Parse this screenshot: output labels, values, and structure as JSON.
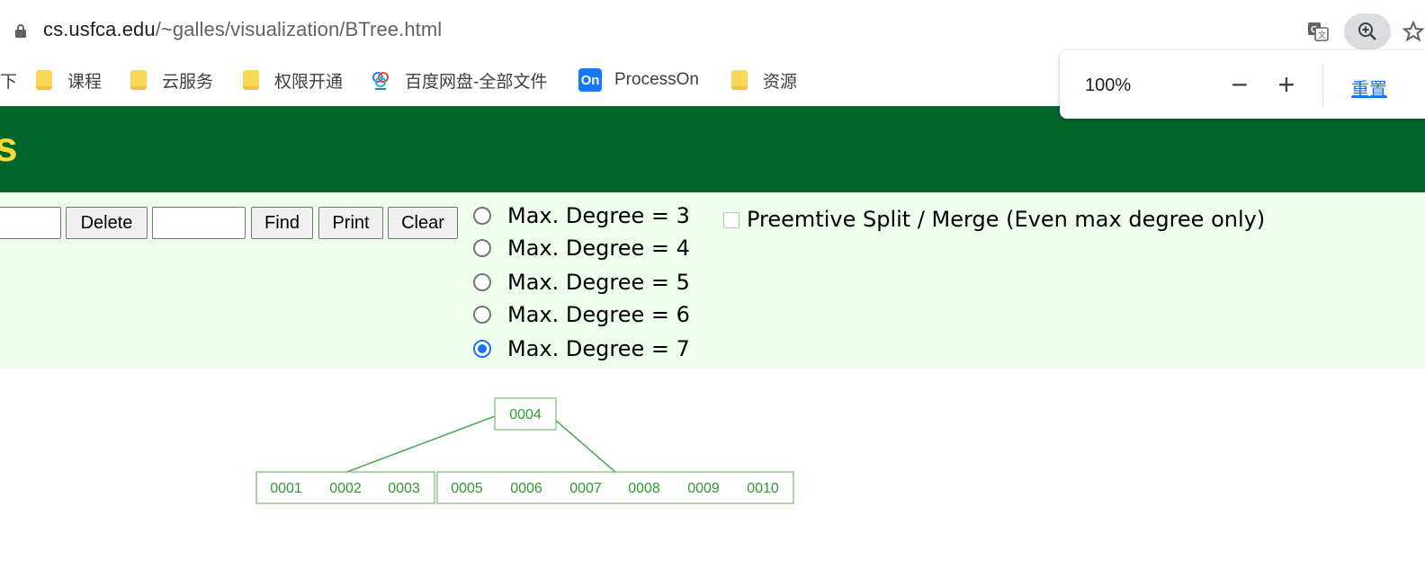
{
  "browser": {
    "url_host": "cs.usfca.edu",
    "url_path": "/~galles/visualization/BTree.html",
    "bookmarks": [
      {
        "label": "课程",
        "icon": "folder-icon"
      },
      {
        "label": "云服务",
        "icon": "folder-icon"
      },
      {
        "label": "权限开通",
        "icon": "folder-icon"
      },
      {
        "label": "百度网盘-全部文件",
        "icon": "baidu-netdisk-icon"
      },
      {
        "label": "ProcessOn",
        "icon": "processon-icon"
      },
      {
        "label": "资源",
        "icon": "folder-icon"
      }
    ],
    "partial_left_char": "下",
    "processon_logo": "On"
  },
  "zoom": {
    "value": "100%",
    "minus": "−",
    "plus": "+",
    "reset": "重置"
  },
  "header": {
    "title_fragment": "s",
    "bg_color": "#00662a",
    "title_color": "#fdd835"
  },
  "controls": {
    "delete_label": "Delete",
    "find_label": "Find",
    "print_label": "Print",
    "clear_label": "Clear",
    "degree_options": [
      {
        "label": "Max. Degree = 3",
        "selected": false
      },
      {
        "label": "Max. Degree = 4",
        "selected": false
      },
      {
        "label": "Max. Degree = 5",
        "selected": false
      },
      {
        "label": "Max. Degree = 6",
        "selected": false
      },
      {
        "label": "Max. Degree = 7",
        "selected": true
      }
    ],
    "preemptive_label": "Preemtive Split / Merge (Even max degree only)",
    "preemptive_checked": false,
    "panel_color": "#eeffee"
  },
  "btree": {
    "color": "#2e9a2e",
    "root_keys": [
      "0004"
    ],
    "left_child_keys": [
      "0001",
      "0002",
      "0003"
    ],
    "right_child_keys": [
      "0005",
      "0006",
      "0007",
      "0008",
      "0009",
      "0010"
    ]
  }
}
